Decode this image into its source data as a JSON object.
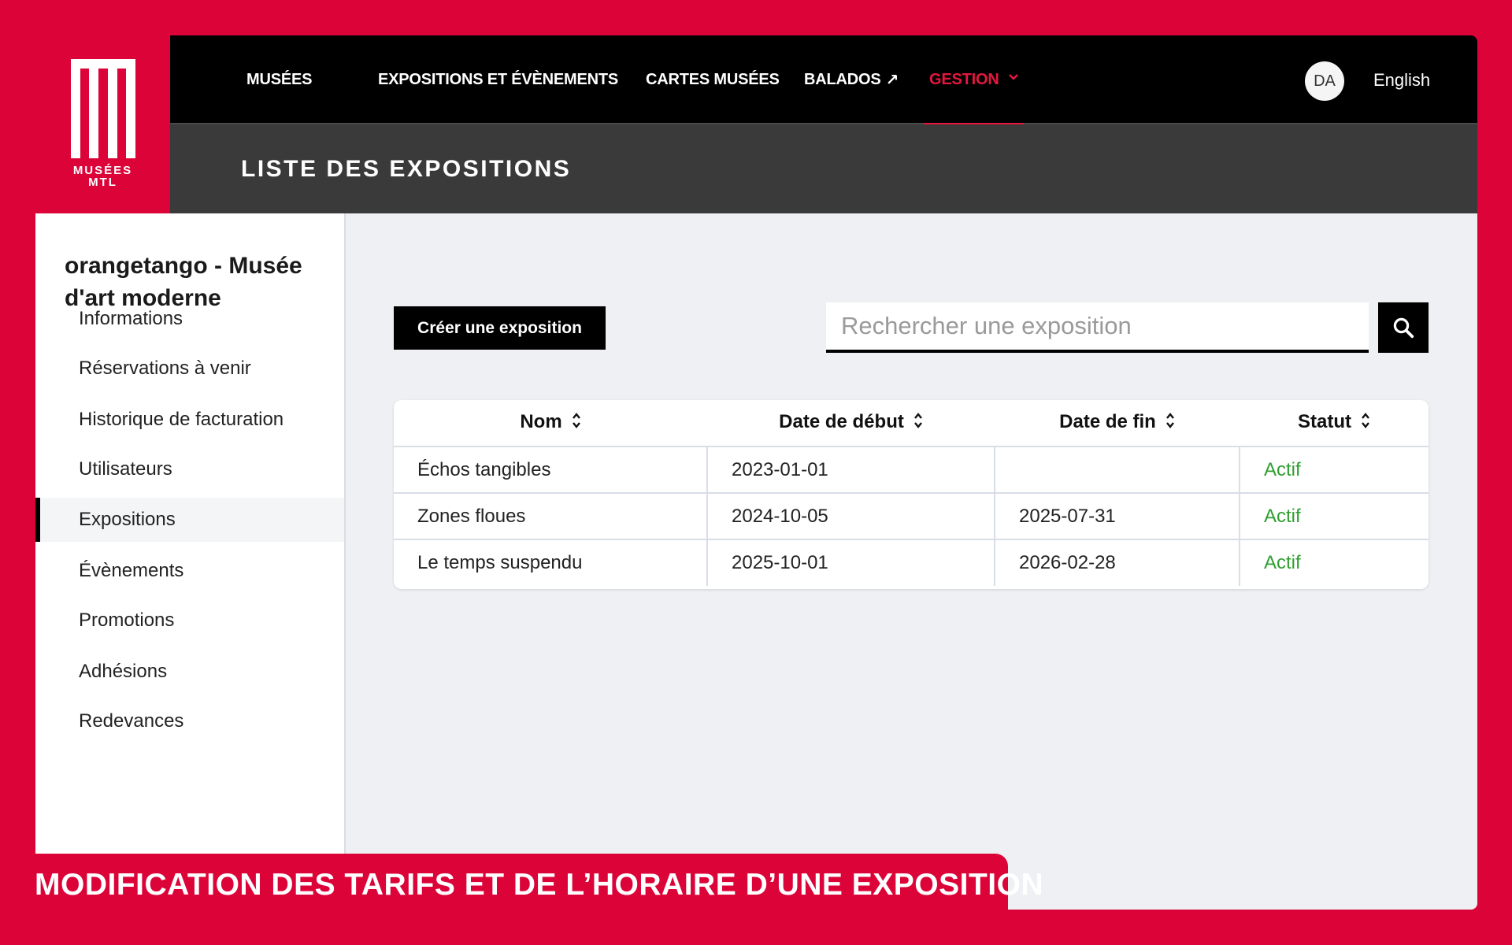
{
  "brand": {
    "logo_text_line1": "MUSÉES",
    "logo_text_line2": "MTL",
    "accent": "#dc0339"
  },
  "nav": {
    "items": [
      {
        "label": "MUSÉES"
      },
      {
        "label": "EXPOSITIONS ET ÉVÈNEMENTS"
      },
      {
        "label": "CARTES MUSÉES"
      },
      {
        "label": "BALADOS",
        "arrow": "↗"
      },
      {
        "label": "GESTION",
        "active": true
      }
    ],
    "avatar_initials": "DA",
    "language": "English"
  },
  "page_title": "LISTE DES EXPOSITIONS",
  "sidebar": {
    "org_name": "orangetango - Musée d'art moderne",
    "items": [
      {
        "label": "Informations"
      },
      {
        "label": "Réservations à venir"
      },
      {
        "label": "Historique de facturation"
      },
      {
        "label": "Utilisateurs"
      },
      {
        "label": "Expositions",
        "active": true
      },
      {
        "label": "Évènements"
      },
      {
        "label": "Promotions"
      },
      {
        "label": "Adhésions"
      },
      {
        "label": "Redevances"
      }
    ]
  },
  "main": {
    "create_button": "Créer une exposition",
    "search_placeholder": "Rechercher une exposition",
    "table": {
      "columns": [
        "Nom",
        "Date de début",
        "Date de fin",
        "Statut"
      ],
      "rows": [
        [
          "Échos tangibles",
          "2023-01-01",
          "",
          "Actif"
        ],
        [
          "Zones floues",
          "2024-10-05",
          "2025-07-31",
          "Actif"
        ],
        [
          "Le temps suspendu",
          "2025-10-01",
          "2026-02-28",
          "Actif"
        ]
      ]
    },
    "status_color": "#2f9e2f"
  },
  "banner": "MODIFICATION DES TARIFS ET DE L’HORAIRE D’UNE EXPOSITION"
}
